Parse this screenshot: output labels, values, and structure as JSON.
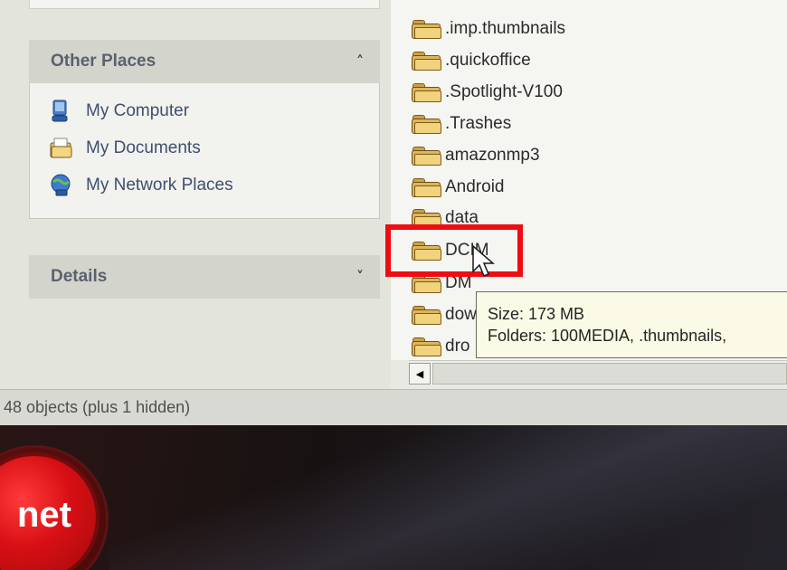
{
  "task_pane": {
    "other_places": {
      "title": "Other Places",
      "collapse_glyph": "˄",
      "items": [
        {
          "label": "My Computer",
          "icon": "computer-icon"
        },
        {
          "label": "My Documents",
          "icon": "documents-icon"
        },
        {
          "label": "My Network Places",
          "icon": "network-icon"
        }
      ]
    },
    "details": {
      "title": "Details",
      "expand_glyph": "˅"
    }
  },
  "file_list": {
    "items": [
      ".imp.thumbnails",
      ".quickoffice",
      ".Spotlight-V100",
      ".Trashes",
      "amazonmp3",
      "Android",
      "data",
      "DCIM",
      "DM",
      "dow",
      "dro"
    ],
    "highlighted": "DCIM"
  },
  "tooltip": {
    "size_line": "Size: 173 MB",
    "folders_line": "Folders: 100MEDIA, .thumbnails,"
  },
  "status_bar": {
    "text": "48 objects (plus 1 hidden)"
  },
  "overlay": {
    "logo_text": "net",
    "highlight_color": "#ee0d13"
  }
}
